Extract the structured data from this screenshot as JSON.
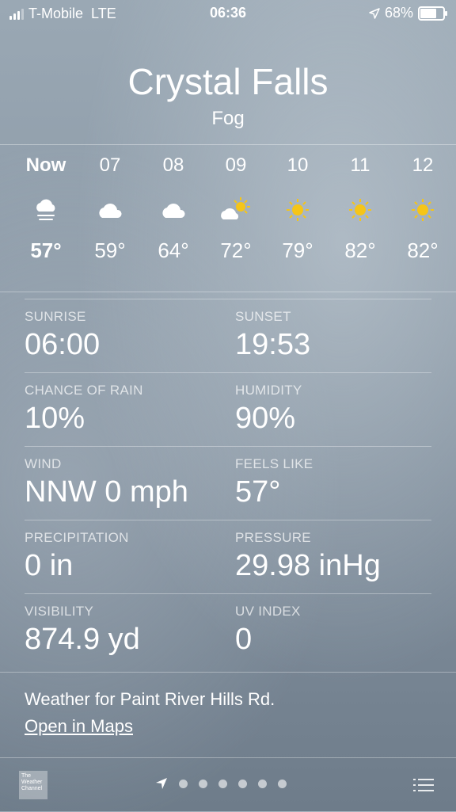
{
  "status_bar": {
    "carrier": "T-Mobile",
    "network": "LTE",
    "time": "06:36",
    "battery": "68%"
  },
  "location": {
    "city": "Crystal Falls",
    "condition": "Fog"
  },
  "hourly": [
    {
      "time": "Now",
      "icon": "fog-icon",
      "temp": "57°"
    },
    {
      "time": "07",
      "icon": "cloud-icon",
      "temp": "59°"
    },
    {
      "time": "08",
      "icon": "cloud-icon",
      "temp": "64°"
    },
    {
      "time": "09",
      "icon": "partly-sunny-icon",
      "temp": "72°"
    },
    {
      "time": "10",
      "icon": "sun-icon",
      "temp": "79°"
    },
    {
      "time": "11",
      "icon": "sun-icon",
      "temp": "82°"
    },
    {
      "time": "12",
      "icon": "sun-icon",
      "temp": "82°"
    }
  ],
  "details": [
    {
      "left": {
        "label": "SUNRISE",
        "value": "06:00"
      },
      "right": {
        "label": "SUNSET",
        "value": "19:53"
      }
    },
    {
      "left": {
        "label": "CHANCE OF RAIN",
        "value": "10%"
      },
      "right": {
        "label": "HUMIDITY",
        "value": "90%"
      }
    },
    {
      "left": {
        "label": "WIND",
        "value": "NNW 0 mph"
      },
      "right": {
        "label": "FEELS LIKE",
        "value": "57°"
      }
    },
    {
      "left": {
        "label": "PRECIPITATION",
        "value": "0 in"
      },
      "right": {
        "label": "PRESSURE",
        "value": "29.98 inHg"
      }
    },
    {
      "left": {
        "label": "VISIBILITY",
        "value": "874.9 yd"
      },
      "right": {
        "label": "UV INDEX",
        "value": "0"
      }
    }
  ],
  "footer": {
    "weather_for": "Weather for Paint River Hills Rd.",
    "open_maps": "Open in Maps"
  },
  "toolbar": {
    "logo_text": "The Weather Channel"
  },
  "colors": {
    "sun": "#f5c518"
  }
}
